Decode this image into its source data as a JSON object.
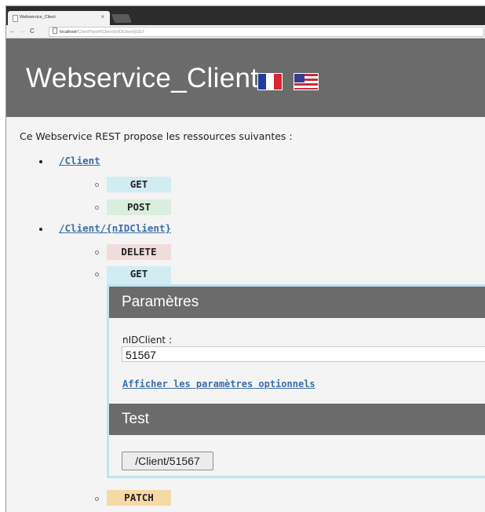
{
  "browser": {
    "tab_title": "Webservice_Client",
    "tab_close": "×",
    "back": "←",
    "forward": "→",
    "reload": "C",
    "url_host": "localhost",
    "url_rest": "/Client?test#/Client/{nIDClient}|GET"
  },
  "header": {
    "title": "Webservice_Client",
    "flags": [
      "flag-france-icon",
      "flag-usa-icon"
    ],
    "colors": {
      "banner": "#6b6b6b",
      "fr_blue": "#1f3d9b",
      "fr_red": "#d8252e",
      "us_red": "#c62d3a",
      "us_blue": "#3b3b8e"
    }
  },
  "intro": "Ce Webservice REST propose les ressources suivantes :",
  "resources": [
    {
      "path": "/Client",
      "methods": [
        "GET",
        "POST"
      ]
    },
    {
      "path": "/Client/{nIDClient}",
      "methods": [
        "DELETE",
        "GET",
        "PATCH"
      ]
    }
  ],
  "get_panel": {
    "params_header": "Paramètres",
    "field_label": "nIDClient :",
    "field_value": "51567",
    "optional_link": "Afficher les paramètres optionnels",
    "test_header": "Test",
    "test_button": "/Client/51567"
  }
}
